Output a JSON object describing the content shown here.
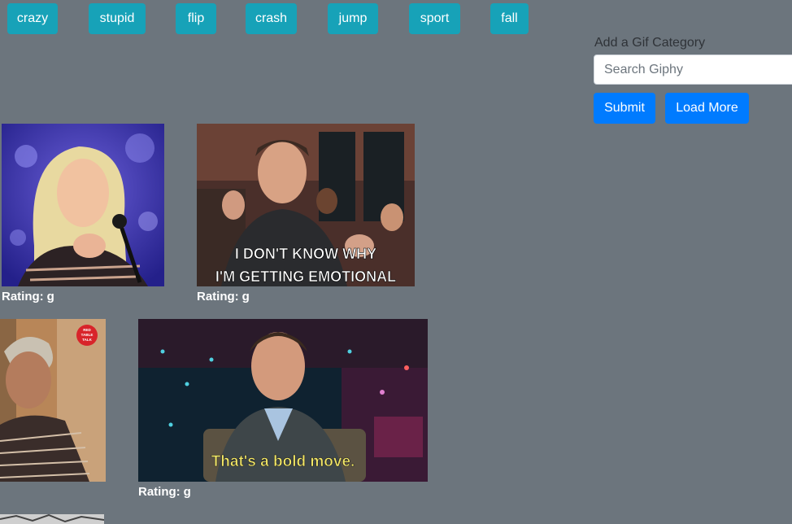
{
  "categories": [
    "crazy",
    "stupid",
    "flip",
    "crash",
    "jump",
    "sport",
    "fall"
  ],
  "form": {
    "label": "Add a Gif Category",
    "placeholder": "Search Giphy",
    "value": "",
    "submit_label": "Submit",
    "load_more_label": "Load More"
  },
  "gifs": [
    {
      "alt": "blonde woman at microphone",
      "rating_label": "Rating:",
      "rating": "g",
      "caption": ""
    },
    {
      "alt": "man in crowd",
      "rating_label": "Rating:",
      "rating": "g",
      "caption_line1": "I DON'T KNOW WHY",
      "caption_line2": "I'M GETTING EMOTIONAL"
    },
    {
      "alt": "woman red table talk",
      "badge": "RED TABLE TALK"
    },
    {
      "alt": "man saying bold move",
      "rating_label": "Rating:",
      "rating": "g",
      "caption": "That's a bold move."
    }
  ],
  "colors": {
    "background": "#6c757d",
    "category_button": "#17a2b8",
    "primary_button": "#007bff"
  }
}
